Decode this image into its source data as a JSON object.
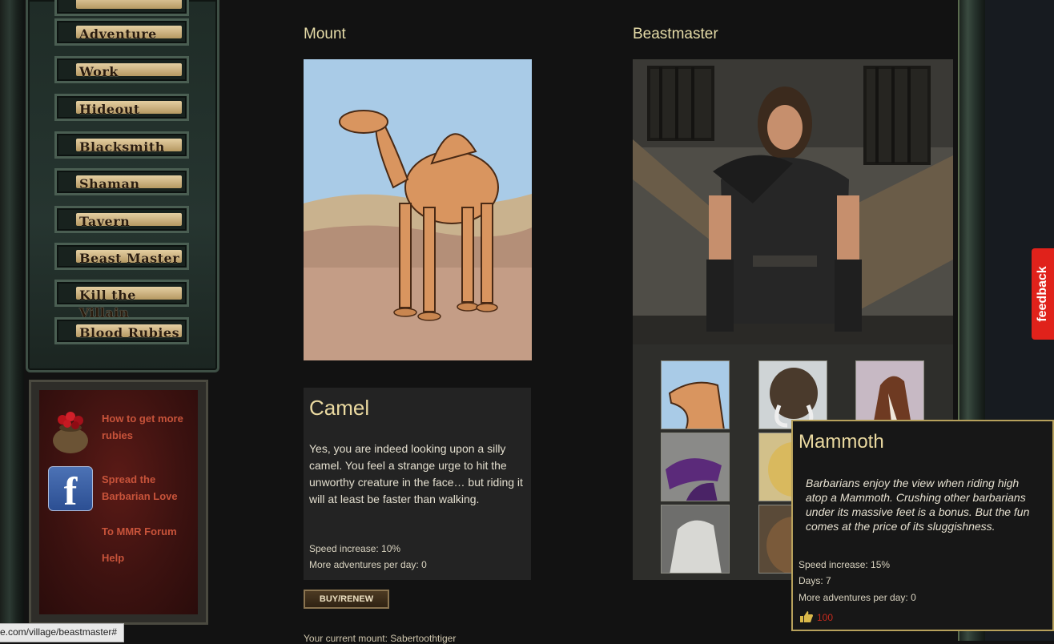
{
  "nav": {
    "items": [
      {
        "label": "Adventure"
      },
      {
        "label": "Work"
      },
      {
        "label": "Hideout"
      },
      {
        "label": "Blacksmith"
      },
      {
        "label": "Shaman"
      },
      {
        "label": "Tavern"
      },
      {
        "label": "Beast Master"
      },
      {
        "label": "Kill the Villain"
      },
      {
        "label": "Blood Rubies"
      }
    ]
  },
  "side": {
    "rubies_link_line1": "How to get more",
    "rubies_link_line2": "rubies",
    "facebook_link_line1": "Spread the",
    "facebook_link_line2": "Barbarian Love",
    "facebook_glyph": "f",
    "forum_link": "To MMR Forum",
    "help_link": "Help"
  },
  "mount": {
    "heading": "Mount",
    "name": "Camel",
    "description": "Yes, you are indeed looking upon a silly camel. You feel a strange urge to hit the unworthy creature in the face… but riding it will at least be faster than walking.",
    "speed": "Speed increase: 10%",
    "adventures": "More adventures per day: 0",
    "buy_label": "BUY/RENEW",
    "current_mount": "Your current mount: Sabertoothtiger"
  },
  "beastmaster": {
    "heading": "Beastmaster",
    "thumbs": [
      "camel-thumb",
      "mammoth-thumb",
      "horse-thumb",
      "raptor-thumb",
      "sabertooth-thumb",
      "white-horse-thumb",
      "bear-thumb"
    ]
  },
  "tooltip": {
    "title": "Mammoth",
    "description": "Barbarians enjoy the view when riding high atop a Mammoth. Crushing other barbarians under its massive feet is a bonus. But the fun comes at the price of its sluggishness.",
    "speed": "Speed increase: 15%",
    "days": "Days: 7",
    "adventures": "More adventures per day: 0",
    "price": "100",
    "price_icon": "thumbs-up-icon"
  },
  "feedback_label": "feedback",
  "status_url": "e.com/village/beastmaster#",
  "colors": {
    "accent_gold": "#ead9a0",
    "link_red": "#c7533a",
    "feedback_red": "#e0221b",
    "tooltip_border": "#b7a15c"
  }
}
